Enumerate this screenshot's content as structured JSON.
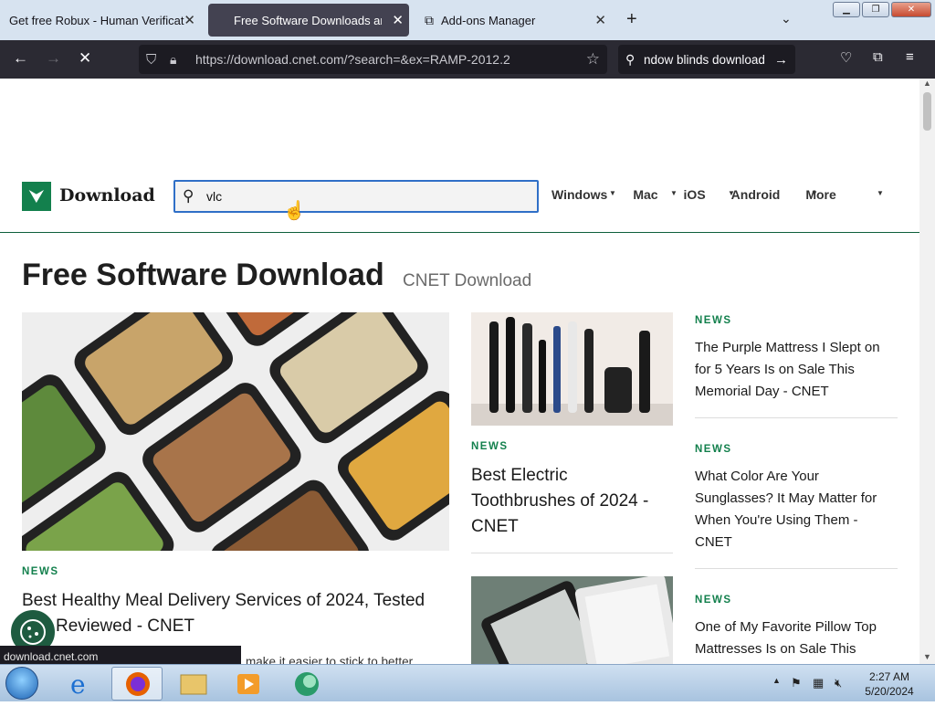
{
  "tabs": [
    {
      "title": "Get free Robux - Human Verification",
      "active": false
    },
    {
      "title": "Free Software Downloads and Reviews",
      "active": true
    },
    {
      "title": "Add-ons Manager",
      "active": false
    }
  ],
  "toolbar": {
    "url": "https://download.cnet.com/?search=&ex=RAMP-2012.2",
    "search_value": "ndow blinds download"
  },
  "site": {
    "logo_text": "Download",
    "search_value": "vlc",
    "nav": [
      "Windows",
      "Mac",
      "iOS",
      "Android",
      "More"
    ]
  },
  "heading": {
    "title": "Free Software Download",
    "subtitle": "CNET Download"
  },
  "articles": {
    "main": {
      "tag": "NEWS",
      "headline": "Best Healthy Meal Delivery Services of 2024, Tested and Reviewed - CNET",
      "snippet": "make it easier to stick to better"
    },
    "middle": {
      "tag": "NEWS",
      "headline": "Best Electric Toothbrushes of 2024 - CNET"
    },
    "right": [
      {
        "tag": "NEWS",
        "headline": "The Purple Mattress I Slept on for 5 Years Is on Sale This Memorial Day - CNET"
      },
      {
        "tag": "NEWS",
        "headline": "What Color Are Your Sunglasses? It May Matter for When You're Using Them - CNET"
      },
      {
        "tag": "NEWS",
        "headline": "One of My Favorite Pillow Top Mattresses Is on Sale This"
      }
    ]
  },
  "status": {
    "link": "download.cnet.com"
  },
  "taskbar": {
    "time": "2:27 AM",
    "date": "5/20/2024"
  },
  "colors": {
    "brand_green": "#13804d",
    "toolbar": "#2b2a33",
    "active_tab": "#434251"
  }
}
